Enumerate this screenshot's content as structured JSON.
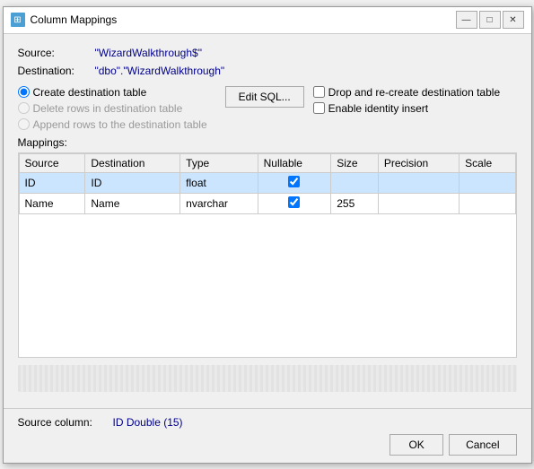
{
  "window": {
    "title": "Column Mappings",
    "icon": "⊞"
  },
  "titlebar": {
    "minimize_label": "—",
    "maximize_label": "□",
    "close_label": "✕"
  },
  "source": {
    "label": "Source:",
    "value": "\"WizardWalkthrough$\""
  },
  "destination": {
    "label": "Destination:",
    "value": "\"dbo\".\"WizardWalkthrough\""
  },
  "options": {
    "create_table_label": "Create destination table",
    "delete_rows_label": "Delete rows in destination table",
    "append_rows_label": "Append rows to the destination table",
    "edit_sql_label": "Edit SQL...",
    "drop_recreate_label": "Drop and re-create destination table",
    "enable_identity_label": "Enable identity insert"
  },
  "mappings": {
    "section_label": "Mappings:",
    "columns": [
      "Source",
      "Destination",
      "Type",
      "Nullable",
      "Size",
      "Precision",
      "Scale"
    ],
    "rows": [
      {
        "source": "ID",
        "destination": "ID",
        "type": "float",
        "nullable": true,
        "size": "",
        "precision": "",
        "scale": "",
        "selected": true
      },
      {
        "source": "Name",
        "destination": "Name",
        "type": "nvarchar",
        "nullable": true,
        "size": "255",
        "precision": "",
        "scale": "",
        "selected": false
      }
    ]
  },
  "footer": {
    "source_col_label": "Source column:",
    "source_col_value": "ID Double (15)",
    "ok_label": "OK",
    "cancel_label": "Cancel"
  }
}
